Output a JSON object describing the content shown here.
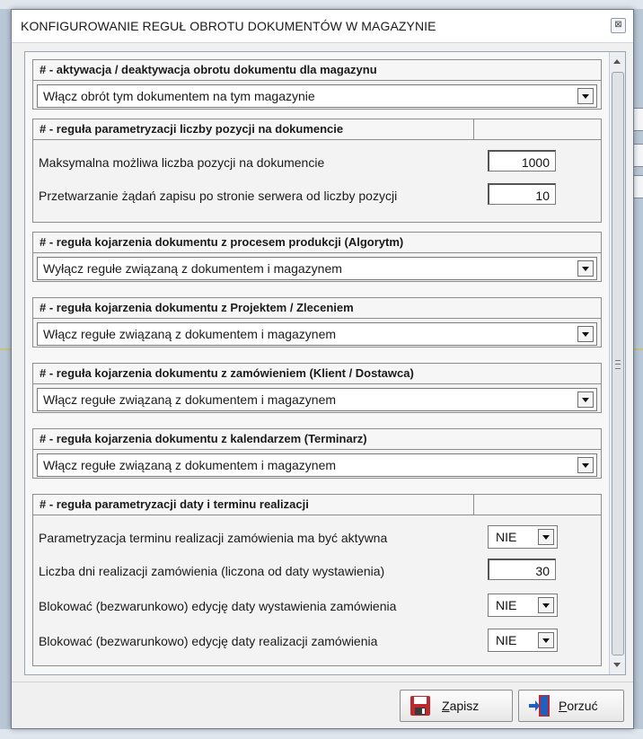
{
  "window": {
    "title": "KONFIGUROWANIE REGUŁ OBROTU DOKUMENTÓW W MAGAZYNIE",
    "close_glyph": "⊠"
  },
  "sections": {
    "activation": {
      "header": "# - aktywacja / deaktywacja obrotu dokumentu dla magazynu",
      "selected": "Włącz obrót  tym dokumentem na tym magazynie"
    },
    "positions": {
      "header": "# - reguła parametryzacji  liczby pozycji  na dokumencie",
      "rows": [
        {
          "label": "Maksymalna możliwa liczba pozycji  na dokumencie",
          "value": "1000"
        },
        {
          "label": "Przetwarzanie żądań zapisu po stronie serwera od liczby pozycji",
          "value": "10"
        }
      ]
    },
    "production": {
      "header": "# - reguła kojarzenia dokumentu z procesem  produkcji  (Algorytm)",
      "selected": "Wyłącz regułe związaną z dokumentem i magazynem"
    },
    "project": {
      "header": "# - reguła kojarzenia  dokumentu z Projektem / Zleceniem",
      "selected": "Włącz  regułe związaną z dokumentem i magazynem"
    },
    "order": {
      "header": "# - reguła kojarzenia dokumentu z zamówieniem (Klient / Dostawca)",
      "selected": "Włącz  regułe związaną z dokumentem i magazynem"
    },
    "calendar": {
      "header": "# - reguła kojarzenia dokumentu z kalendarzem (Terminarz)",
      "selected": "Włącz  regułe związaną z dokumentem i magazynem"
    },
    "dates": {
      "header": "# - reguła parametryzacji daty i terminu realizacji",
      "rows": [
        {
          "label": "Parametryzacja  terminu realizacji zamówienia ma być aktywna",
          "value": "NIE"
        },
        {
          "label": "Liczba dni realizacji zamówienia (liczona od daty wystawienia)",
          "value": "30"
        },
        {
          "label": "Blokować (bezwarunkowo) edycję daty wystawienia zamówienia",
          "value": "NIE"
        },
        {
          "label": "Blokować (bezwarunkowo) edycję daty realizacji zamówienia",
          "value": "NIE"
        }
      ]
    }
  },
  "footer": {
    "save_mnemonic": "Z",
    "save_rest": "apisz",
    "cancel_mnemonic": "P",
    "cancel_rest": "orzuć"
  },
  "colors": {
    "save_icon": "#c0282d",
    "cancel_icon": "#1f5fbf",
    "door_icon": "#c0282d"
  }
}
